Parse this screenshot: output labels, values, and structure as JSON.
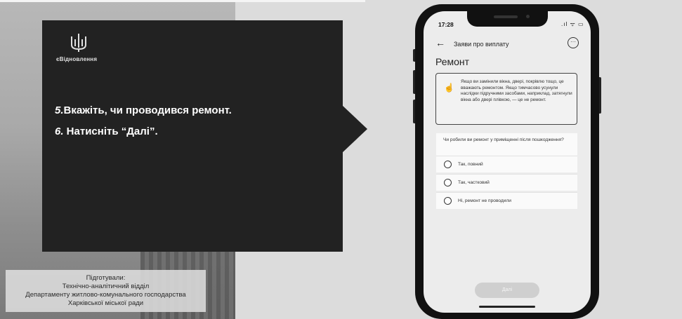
{
  "slide": {
    "brand": "єВідновлення",
    "steps": [
      {
        "num": "5.",
        "text": "Вкажіть, чи проводився ремонт."
      },
      {
        "num": "6.",
        "text": " Натисніть “Далі”."
      }
    ],
    "credits": [
      "Підготували:",
      "Технічно-аналітичний відділ",
      "Департаменту житлово-комунального господарства",
      "Харківської міської ради"
    ]
  },
  "phone": {
    "time": "17:28",
    "status_icons": ".ıl ᯤ ▭",
    "nav_title": "Заяви про виплату",
    "back_icon": "arrow-left-icon",
    "more_icon": "more-icon",
    "heading": "Ремонт",
    "info_text": "Якщо ви замінили вікна, двері, покрівлю тощо, це вважають ремонтом. Якщо тимчасово усунули наслідки підручними засобами, наприклад, затягнули вікна або двері плівкою, — це не ремонт.",
    "question": "Чи робили ви ремонт у приміщенні після пошкодження?",
    "options": [
      "Так, повний",
      "Так, частковий",
      "Ні, ремонт не проводили"
    ],
    "next_label": "Далі"
  }
}
